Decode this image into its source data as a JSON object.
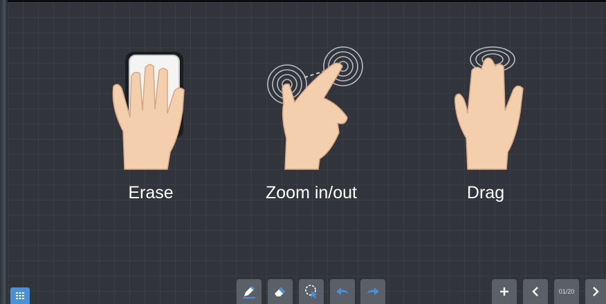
{
  "gestures": [
    {
      "label": "Erase"
    },
    {
      "label": "Zoom in/out"
    },
    {
      "label": "Drag"
    }
  ],
  "toolbar": {
    "icons": [
      "pen-icon",
      "eraser-icon",
      "lasso-select-icon",
      "undo-icon",
      "redo-icon"
    ]
  },
  "pager": {
    "page_indicator": "01/20",
    "icons": [
      "plus-icon",
      "chevron-left-icon",
      "chevron-right-icon"
    ]
  },
  "colors": {
    "board": "#31343a",
    "button": "#5b6068",
    "accent": "#4a90d9",
    "skin": "#f3cfae"
  }
}
